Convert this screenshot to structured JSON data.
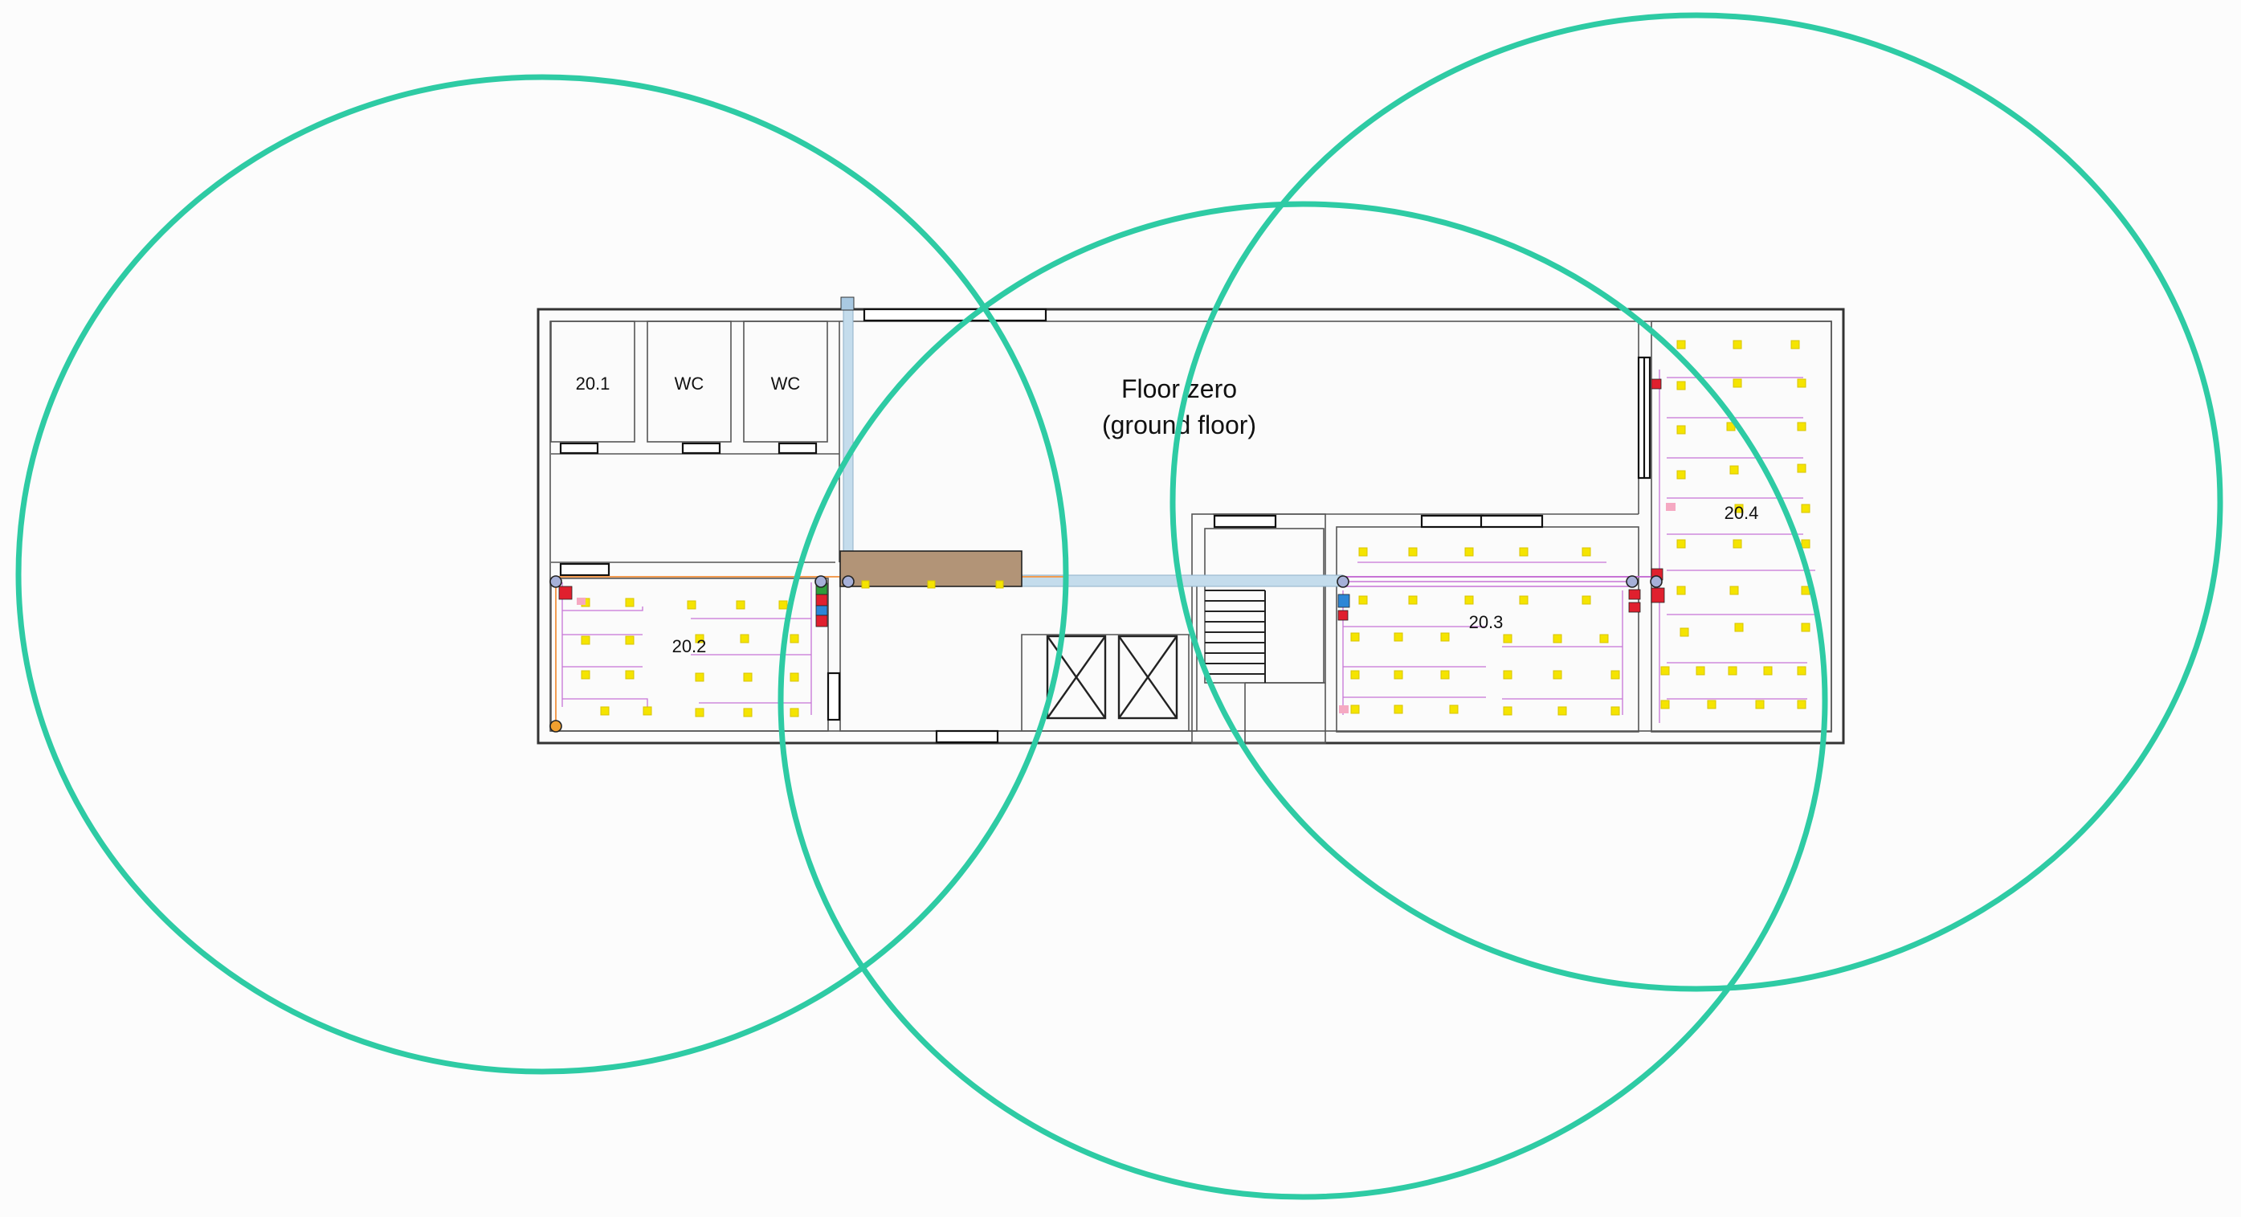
{
  "floor_label": {
    "line1": "Floor zero",
    "line2": "(ground floor)"
  },
  "rooms": [
    {
      "id": "room-20-1",
      "label": "20.1"
    },
    {
      "id": "wc-1",
      "label": "WC"
    },
    {
      "id": "wc-2",
      "label": "WC"
    },
    {
      "id": "room-20-2",
      "label": "20.2"
    },
    {
      "id": "room-20-3",
      "label": "20.3"
    },
    {
      "id": "room-20-4",
      "label": "20.4"
    }
  ],
  "colors": {
    "coverage_circle": "#2ecba4",
    "wall": "#333333",
    "light_fixture": "#f5e400",
    "wiring": "#c774d6",
    "pipe": "#b8d4e6",
    "panel_red": "#e0202e",
    "beam": "#b08a6a"
  }
}
